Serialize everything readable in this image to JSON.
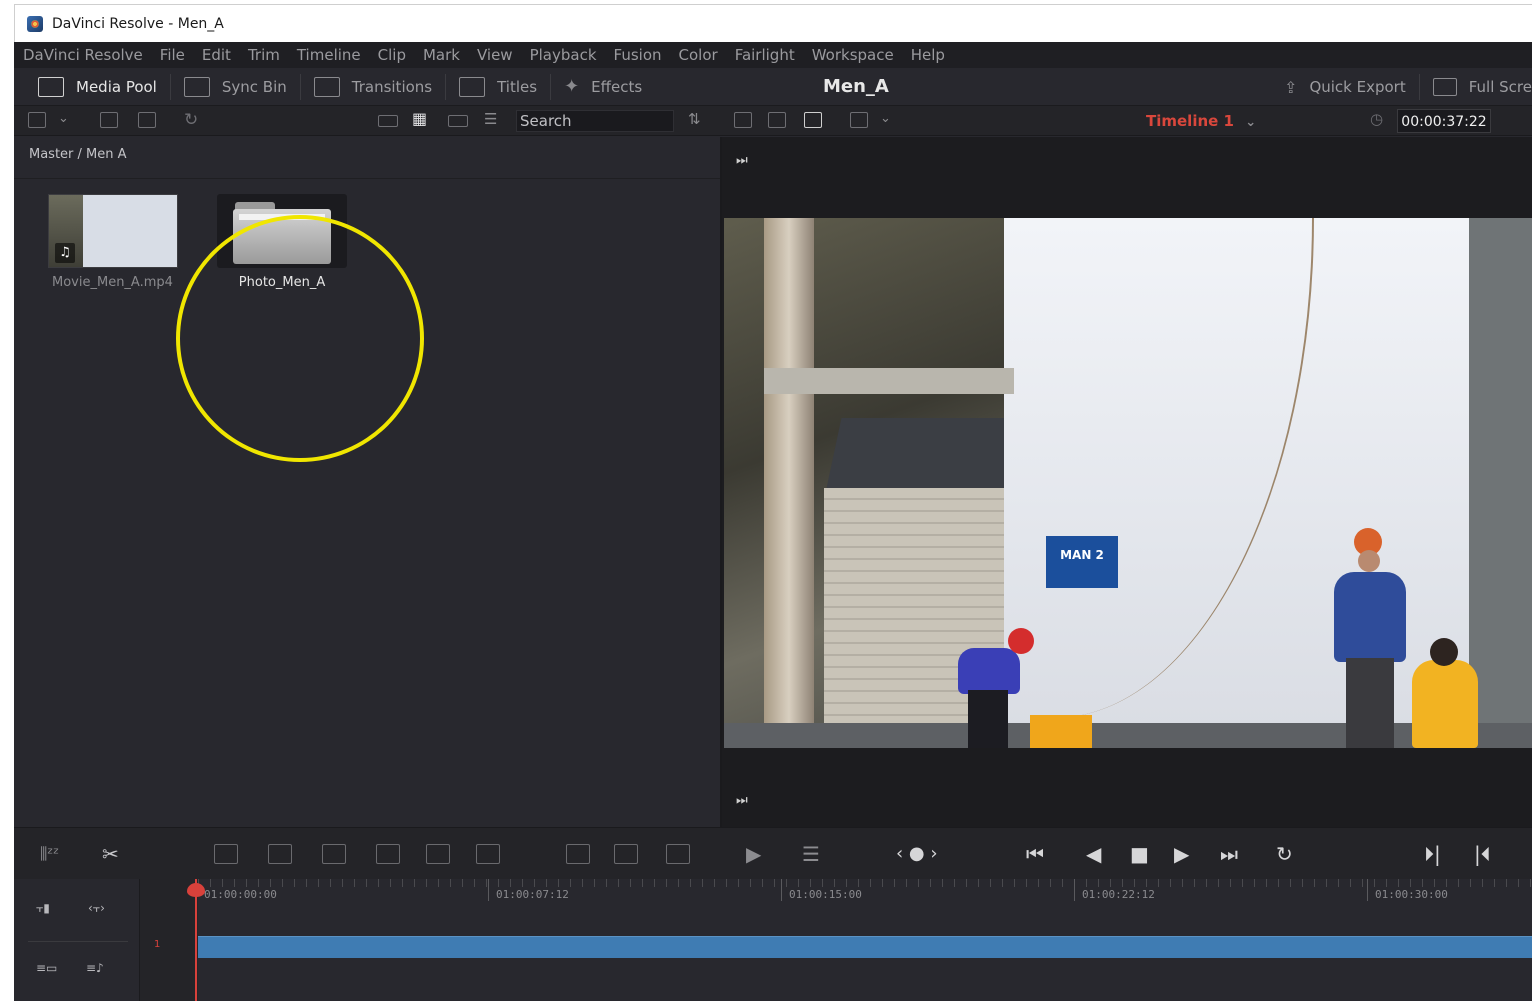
{
  "window": {
    "title": "DaVinci Resolve - Men_A"
  },
  "menu": [
    "DaVinci Resolve",
    "File",
    "Edit",
    "Trim",
    "Timeline",
    "Clip",
    "Mark",
    "View",
    "Playback",
    "Fusion",
    "Color",
    "Fairlight",
    "Workspace",
    "Help"
  ],
  "toolbar": {
    "media_pool": "Media Pool",
    "sync_bin": "Sync Bin",
    "transitions": "Transitions",
    "titles": "Titles",
    "effects": "Effects",
    "project_title": "Men_A",
    "quick_export": "Quick Export",
    "full_screen": "Full Scre"
  },
  "search": {
    "value": "Search"
  },
  "viewer": {
    "timeline_name": "Timeline 1",
    "timecode": "00:00:37:22",
    "sign_text": "MAN 2"
  },
  "media_pool": {
    "breadcrumb": "Master / Men A",
    "items": [
      {
        "label": "Movie_Men_A.mp4",
        "type": "video"
      },
      {
        "label": "Photo_Men_A",
        "type": "folder"
      }
    ]
  },
  "timeline": {
    "ruler_labels": [
      "01:00:00:00",
      "01:00:07:12",
      "01:00:15:00",
      "01:00:22:12",
      "01:00:30:00"
    ],
    "track_number": "1"
  },
  "colors": {
    "accent_red": "#d8413b",
    "annotation_yellow": "#f0e600",
    "clip_blue": "#3f7cb3"
  }
}
